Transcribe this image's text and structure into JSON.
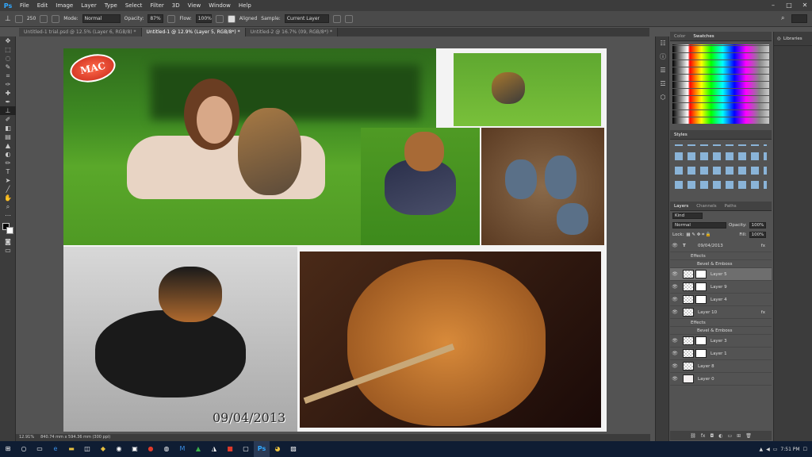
{
  "app": {
    "logo": "Ps"
  },
  "menu": [
    "File",
    "Edit",
    "Image",
    "Layer",
    "Type",
    "Select",
    "Filter",
    "3D",
    "View",
    "Window",
    "Help"
  ],
  "options": {
    "brush_size": "250",
    "mode_label": "Mode:",
    "mode_value": "Normal",
    "opacity_label": "Opacity:",
    "opacity_value": "87%",
    "flow_label": "Flow:",
    "flow_value": "100%",
    "aligned_label": "Aligned",
    "sample_label": "Sample:",
    "sample_value": "Current Layer"
  },
  "tabs": [
    {
      "label": "Untitled-1 trial.psd @ 12.5% (Layer 6, RGB/8) *"
    },
    {
      "label": "Untitled-1 @ 12.9% (Layer 5, RGB/8*) *"
    },
    {
      "label": "Untitled-2 @ 16.7% (09, RGB/8*) *"
    }
  ],
  "canvas": {
    "date_text": "09/04/2013",
    "logo_text": "MAC"
  },
  "status": {
    "zoom": "12.91%",
    "doc_size": "840.74 mm x 594.36 mm (300 ppi)"
  },
  "panels": {
    "color_tabs": [
      "Color",
      "Swatches"
    ],
    "styles_tab": "Styles",
    "layers_tabs": [
      "Layers",
      "Channels",
      "Paths"
    ],
    "kind_label": "Kind",
    "blend_mode": "Normal",
    "opacity_label": "Opacity:",
    "opacity_value": "100%",
    "lock_label": "Lock:",
    "fill_label": "Fill:",
    "fill_value": "100%",
    "libraries_label": "Libraries",
    "layers": [
      {
        "name": "09/04/2013",
        "type": "text",
        "fx": true
      },
      {
        "name": "Effects",
        "type": "effect"
      },
      {
        "name": "Bevel & Emboss",
        "type": "effect-sub"
      },
      {
        "name": "Layer 5",
        "type": "layer",
        "selected": true
      },
      {
        "name": "Layer 9",
        "type": "layer"
      },
      {
        "name": "Layer 4",
        "type": "layer"
      },
      {
        "name": "Layer 10",
        "type": "layer",
        "fx": true
      },
      {
        "name": "Effects",
        "type": "effect"
      },
      {
        "name": "Bevel & Emboss",
        "type": "effect-sub"
      },
      {
        "name": "Layer 3",
        "type": "layer"
      },
      {
        "name": "Layer 1",
        "type": "layer"
      },
      {
        "name": "Layer 8",
        "type": "layer"
      },
      {
        "name": "Layer 0",
        "type": "layer"
      }
    ]
  },
  "taskbar": {
    "clock": "7:51 PM"
  }
}
